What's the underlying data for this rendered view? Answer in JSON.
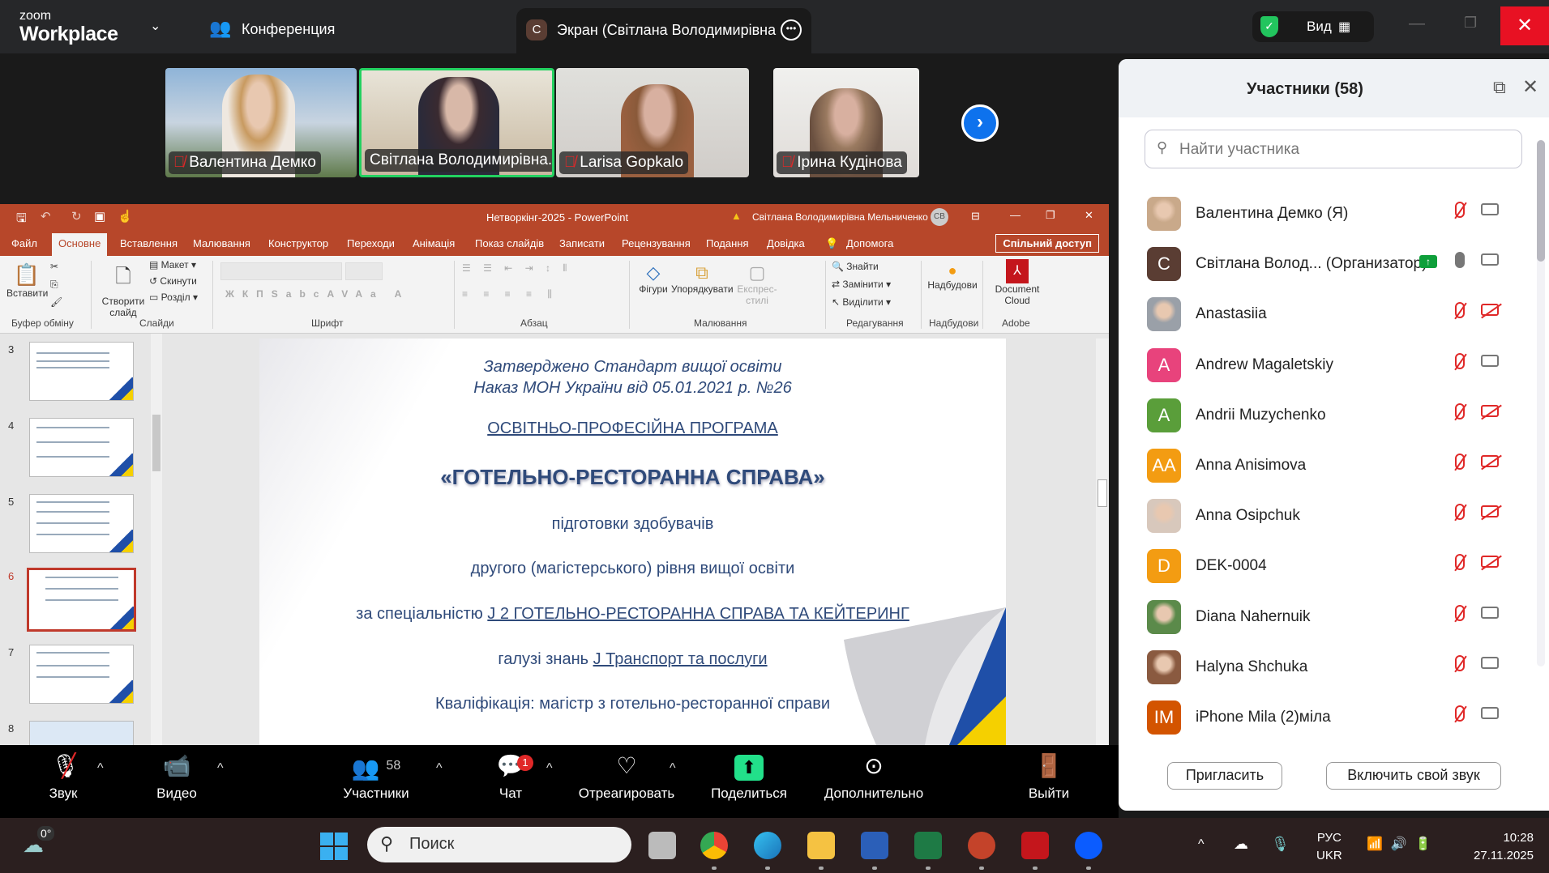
{
  "zoom": {
    "logo_small": "zoom",
    "logo_big": "Workplace",
    "meeting_label": "Конференция",
    "screen_tab": "Экран (Світлана Володимирівна",
    "screen_tab_initial": "С",
    "view_label": "Вид"
  },
  "videos": [
    {
      "name": "Валентина Демко"
    },
    {
      "name": "Світлана Володимирівна..."
    },
    {
      "name": "Larisa Gopkalo"
    },
    {
      "name": "Ірина  Кудінова"
    }
  ],
  "ppt": {
    "title": "Нетворкінг-2025  -  PowerPoint",
    "user": "Світлана Володимирівна Мельниченко",
    "user_initials": "СВ",
    "tabs": [
      "Файл",
      "Основне",
      "Вставлення",
      "Малювання",
      "Конструктор",
      "Переходи",
      "Анімація",
      "Показ слайдів",
      "Записати",
      "Рецензування",
      "Подання",
      "Довідка",
      "Допомога"
    ],
    "share": "Спільний доступ",
    "ribbon": {
      "paste": "Вставити",
      "new_slide": "Створити слайд",
      "layout": "Макет",
      "reset": "Скинути",
      "section": "Розділ",
      "shapes": "Фігури",
      "arrange": "Упорядкувати",
      "quick_styles": "Експрес-стилі",
      "find": "Знайти",
      "replace": "Замінити",
      "select": "Виділити",
      "addins": "Надбудови",
      "doc_cloud": "Document Cloud"
    },
    "groups": [
      "Буфер обміну",
      "Слайди",
      "Шрифт",
      "Абзац",
      "Малювання",
      "Редагування",
      "Надбудови",
      "Adobe"
    ],
    "thumb_numbers": [
      "3",
      "4",
      "5",
      "6",
      "7",
      "8"
    ],
    "selected_slide": "6",
    "slide": {
      "l1": "Затверджено Стандарт вищої освіти",
      "l2": "Наказ МОН України від 05.01.2021 р. №26",
      "l3": "ОСВІТНЬО-ПРОФЕСІЙНА ПРОГРАМА",
      "l4": "«ГОТЕЛЬНО-РЕСТОРАННА СПРАВА»",
      "l5": "підготовки здобувачів",
      "l6": "другого (магістерського) рівня вищої освіти",
      "l7a": "за спеціальністю ",
      "l7b": "J 2 ГОТЕЛЬНО-РЕСТОРАННА СПРАВА ТА КЕЙТЕРИНГ",
      "l8a": "галузі знань ",
      "l8b": "J Транспорт та послуги",
      "l9": "Кваліфікація: магістр з готельно-ресторанної справи"
    }
  },
  "participants": {
    "title": "Участники (58)",
    "search_placeholder": "Найти участника",
    "list": [
      {
        "name": "Валентина Демко (Я)",
        "initials": "",
        "color": "#c9a98a",
        "mic": "off",
        "cam": "on"
      },
      {
        "name": "Світлана Волод...  (Организатор)",
        "initials": "С",
        "color": "#5a3d33",
        "mic": "on",
        "cam": "on"
      },
      {
        "name": "Anastasiia",
        "initials": "",
        "color": "#9aa0a8",
        "mic": "off",
        "cam": "off"
      },
      {
        "name": "Andrew Magaletskiy",
        "initials": "A",
        "color": "#e8437c",
        "mic": "off",
        "cam": "on"
      },
      {
        "name": "Andrii Muzychenko",
        "initials": "A",
        "color": "#5a9e3a",
        "mic": "off",
        "cam": "off"
      },
      {
        "name": "Anna Anisimova",
        "initials": "AA",
        "color": "#f39c12",
        "mic": "off",
        "cam": "off"
      },
      {
        "name": "Anna Osipchuk",
        "initials": "",
        "color": "#d8c8bc",
        "mic": "off",
        "cam": "off"
      },
      {
        "name": "DEK-0004",
        "initials": "D",
        "color": "#f39c12",
        "mic": "off",
        "cam": "off"
      },
      {
        "name": "Diana Nahernuik",
        "initials": "",
        "color": "#5b8a4a",
        "mic": "off",
        "cam": "on"
      },
      {
        "name": "Halyna Shchuka",
        "initials": "",
        "color": "#8a5a40",
        "mic": "off",
        "cam": "on"
      },
      {
        "name": "iPhone Mila (2)міла",
        "initials": "IM",
        "color": "#d35400",
        "mic": "off",
        "cam": "on"
      }
    ],
    "invite": "Пригласить",
    "unmute": "Включить свой звук"
  },
  "toolbar": {
    "audio": "Звук",
    "video": "Видео",
    "participants": "Участники",
    "participants_count": "58",
    "chat": "Чат",
    "chat_badge": "1",
    "react": "Отреагировать",
    "share": "Поделиться",
    "more": "Дополнительно",
    "leave": "Выйти"
  },
  "taskbar": {
    "weather": "0°",
    "search": "Поиск",
    "lang1": "РУС",
    "lang2": "UKR",
    "time": "10:28",
    "date": "27.11.2025"
  }
}
